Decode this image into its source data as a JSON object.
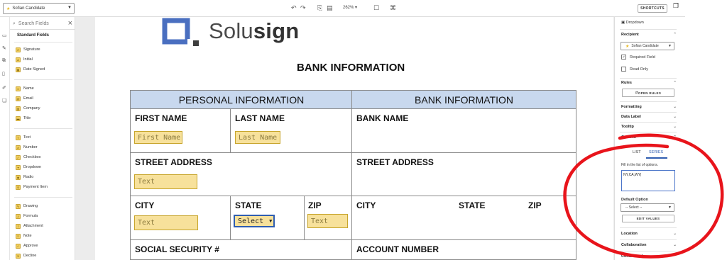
{
  "toolbar": {
    "recipient": "Sofian Candidate",
    "zoom": "262%",
    "shortcuts": "SHORTCUTS"
  },
  "left_panel": {
    "search_placeholder": "Search Fields",
    "section_title": "Standard Fields",
    "group1": [
      "Signature",
      "Initial",
      "Date Signed"
    ],
    "group2": [
      "Name",
      "Email",
      "Company",
      "Title"
    ],
    "group3": [
      "Text",
      "Number",
      "Checkbox",
      "Dropdown",
      "Radio",
      "Payment Item"
    ],
    "group4": [
      "Drawing",
      "Formula",
      "Attachment",
      "Note",
      "Approve",
      "Decline"
    ]
  },
  "document": {
    "logo_prefix": "Solu",
    "logo_bold": "sign",
    "title": "BANK INFORMATION",
    "headers": {
      "personal": "PERSONAL INFORMATION",
      "bank": "BANK INFORMATION"
    },
    "labels": {
      "first_name": "FIRST NAME",
      "last_name": "LAST NAME",
      "bank_name": "BANK NAME",
      "street_left": "STREET ADDRESS",
      "street_right": "STREET ADDRESS",
      "city_left": "CITY",
      "state_left": "STATE",
      "zip_left": "ZIP",
      "city_right": "CITY",
      "state_right": "STATE",
      "zip_right": "ZIP",
      "ssn": "SOCIAL SECURITY #",
      "account_number": "ACCOUNT NUMBER"
    },
    "fields": {
      "first_name": "First Name",
      "last_name": "Last Name",
      "street": "Text",
      "city": "Text",
      "state": "Select",
      "zip": "Text"
    }
  },
  "right_panel": {
    "field_type": "Dropdown",
    "recipient_heading": "Recipient",
    "recipient_value": "Sofian Candidate",
    "required_field": "Required Field",
    "read_only": "Read Only",
    "rules_heading": "Rules",
    "open_rules": "OPEN RULES",
    "formatting": "Formatting",
    "data_label": "Data Label",
    "tooltip": "Tooltip",
    "options": "Options",
    "tab_list": "LIST",
    "tab_series": "SERIES",
    "fill_hint": "Fill in the list of options.",
    "options_value": "NY,CA,WY|",
    "default_option": "Default Option",
    "default_select": "-- Select --",
    "edit_values": "EDIT VALUES",
    "location": "Location",
    "collaboration": "Collaboration",
    "conditional": "Conditional"
  },
  "colors": {
    "header_fill": "#c8d8ee",
    "field_fill": "#f7e19b",
    "field_border": "#c7a52c",
    "selected_border": "#2f5db0",
    "annotation": "#e8141b",
    "logo": "#4a6fc0"
  }
}
